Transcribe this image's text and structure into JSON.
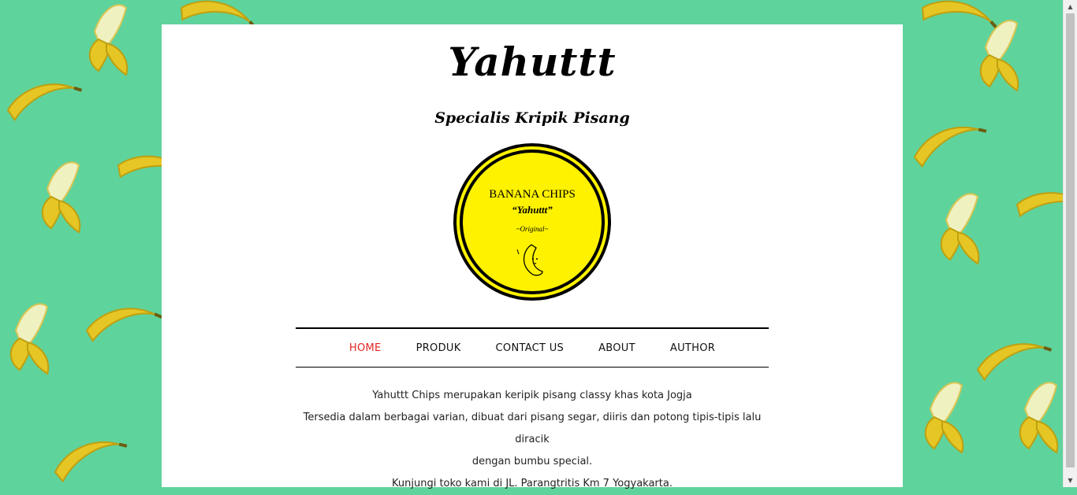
{
  "site": {
    "title": "Yahuttt",
    "tagline": "Specialis Kripik Pisang"
  },
  "logo": {
    "line1": "BANANA CHIPS",
    "line2": "“Yahuttt”",
    "line3": "~Original~",
    "icon": "banana-character-icon",
    "fill_color": "#fff200",
    "ring_color": "#000000"
  },
  "nav": {
    "items": [
      {
        "label": "HOME",
        "active": true
      },
      {
        "label": "PRODUK"
      },
      {
        "label": "CONTACT US"
      },
      {
        "label": "ABOUT"
      },
      {
        "label": "AUTHOR"
      }
    ],
    "active_color": "#e32222"
  },
  "content": {
    "lines": [
      "Yahuttt Chips merupakan keripik pisang classy khas kota Jogja",
      "Tersedia dalam berbagai varian, dibuat dari pisang segar, diiris dan potong tipis-tipis lalu diracik",
      "dengan bumbu special.",
      "Kunjungi toko kami di JL. Parangtritis Km 7 Yogyakarta."
    ]
  },
  "background": {
    "color": "#5fd39c",
    "pattern": "banana-pattern"
  }
}
